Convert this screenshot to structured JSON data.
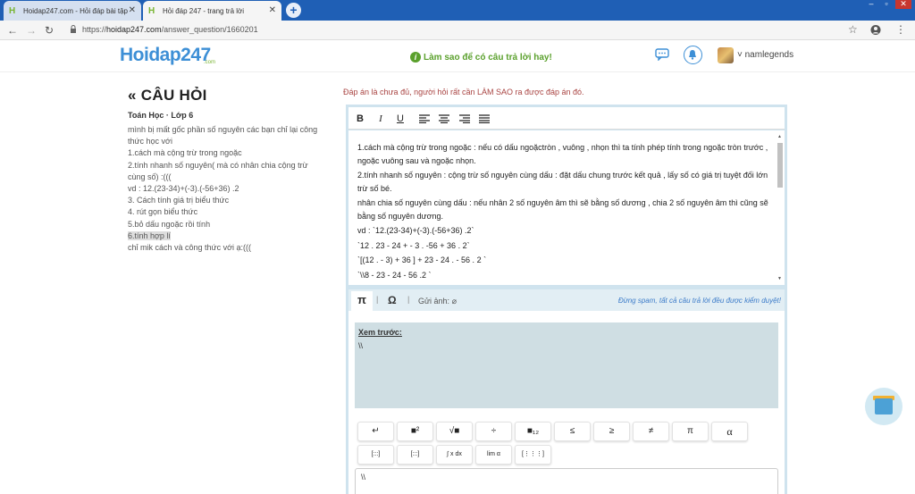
{
  "browser": {
    "tabs": [
      {
        "title": "Hoidap247.com - Hỏi đáp bài tập",
        "active": false
      },
      {
        "title": "Hỏi đáp 247 - trang trả lời",
        "active": true
      }
    ],
    "url_prefix": "https://",
    "url_host": "hoidap247.com",
    "url_path": "/answer_question/1660201"
  },
  "header": {
    "logo": "Hoidap247",
    "logo_sub": ".com",
    "tip": "Làm sao để có câu trả lời hay!",
    "username": "namlegends"
  },
  "question": {
    "title": "CÂU HỎI",
    "meta": "Toán Học · Lớp 6",
    "lines": [
      "mình bị mất gốc phần số nguyên các bạn chỉ lại công thức học với",
      "1.cách mà cộng trừ trong ngoặc",
      "2.tính nhanh số nguyên( mà có nhân chia cộng trừ cùng số) :(((",
      "vd : 12.(23-34)+(-3).(-56+36) .2",
      "3. Cách tính giá trị biểu thức",
      "4. rút gọn biểu thức",
      "5.bỏ dấu ngoặc rồi tính"
    ],
    "highlight_line": "6.tính hợp lí",
    "last_line": "chỉ mik cách và công thức với ạ:((("
  },
  "answer": {
    "warning": "Đáp án là chưa đủ, người hỏi rất cần LÀM SAO ra được đáp án đó.",
    "toolbar": {
      "bold": "B",
      "italic": "I",
      "underline": "U"
    },
    "content": [
      "1.cách mà cộng trừ trong ngoặc : nếu có dấu ngoặctròn , vuông , nhọn thì ta tính phép tính trong ngoặc tròn trước , ngoặc vuông sau và ngoặc nhọn.",
      "2.tính nhanh số nguyên : cộng trừ số nguyên cùng dấu : đặt dấu chung trước kết quả , lấy số có giá trị tuyệt đối lớn trừ số bé.",
      "nhân chia số nguyên cùng dấu : nếu nhân 2 số nguyên âm thì sẽ bằng số dương , chia 2 số nguyên âm thì cũng sẽ bằng số nguyên dương.",
      "vd : `12.(23-34)+(-3).(-56+36) .2`",
      "`12 . 23 - 24 + - 3 . -56 + 36 . 2`",
      "`[(12 . - 3) + 36 ] +  23 - 24 . - 56   . 2 `",
      "`\\\\8 - 23 - 24 - 56 .2 `"
    ],
    "mathbar": {
      "pi": "π",
      "omega": "Ω",
      "send_image": "Gửi ảnh:",
      "spam_note": "Đừng spam, tất cả câu trả lời đều được kiểm duyệt!"
    },
    "preview_label": "Xem trước:",
    "preview_value": "\\\\",
    "symbols_row1": [
      "↵",
      "■²",
      "√■",
      "÷",
      "■₁₂",
      "≤",
      "≥",
      "≠",
      "π",
      "α"
    ],
    "symbols_row2": [
      "[:::]",
      "[:::]",
      "∫ x dx",
      "lim α",
      "[⋮⋮⋮]"
    ],
    "input_value": "\\\\"
  }
}
